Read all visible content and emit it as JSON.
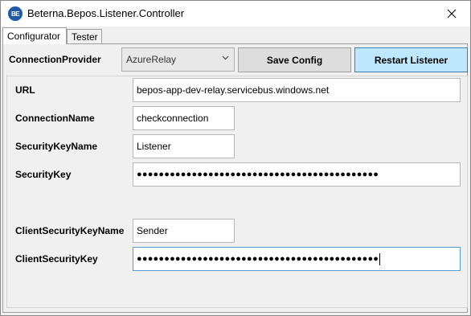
{
  "window": {
    "icon_text": "BE",
    "title": "Beterna.Bepos.Listener.Controller",
    "close_glyph": "✕"
  },
  "tabs": [
    {
      "label": "Configurator",
      "active": true
    },
    {
      "label": "Tester",
      "active": false
    }
  ],
  "toolbar": {
    "connection_provider_label": "ConnectionProvider",
    "connection_provider_value": "AzureRelay",
    "save_label": "Save Config",
    "restart_label": "Restart Listener"
  },
  "form": {
    "url_label": "URL",
    "url_value": "bepos-app-dev-relay.servicebus.windows.net",
    "connection_name_label": "ConnectionName",
    "connection_name_value": "checkconnection",
    "security_key_name_label": "SecurityKeyName",
    "security_key_name_value": "Listener",
    "security_key_label": "SecurityKey",
    "security_key_value": "●●●●●●●●●●●●●●●●●●●●●●●●●●●●●●●●●●●●●●●●●●●●",
    "client_security_key_name_label": "ClientSecurityKeyName",
    "client_security_key_name_value": "Sender",
    "client_security_key_label": "ClientSecurityKey",
    "client_security_key_value": "●●●●●●●●●●●●●●●●●●●●●●●●●●●●●●●●●●●●●●●●●●●●"
  },
  "icons": {
    "app": "beterna-logo-icon",
    "close": "close-icon",
    "dropdown": "chevron-down-icon"
  },
  "colors": {
    "restart_button_bg": "#bee6fd",
    "restart_button_border": "#3c7fb1",
    "focus_border": "#5a9ad6"
  }
}
